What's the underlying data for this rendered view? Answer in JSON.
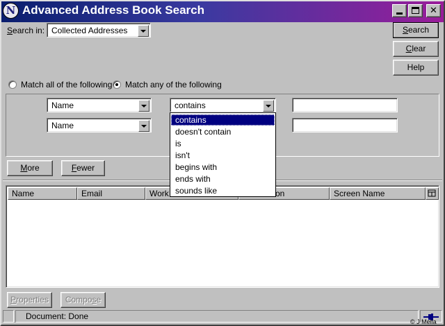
{
  "window": {
    "title": "Advanced Address Book Search",
    "app_icon_letter": "N",
    "controls": {
      "minimize": "minimize-icon",
      "maximize": "maximize-icon",
      "close": "close-icon"
    }
  },
  "search_in": {
    "label_pre": "",
    "label_mnemonic": "S",
    "label_post": "earch in:",
    "value": "Collected Addresses"
  },
  "buttons": {
    "search": {
      "mnemonic": "S",
      "rest": "earch"
    },
    "clear": {
      "mnemonic": "C",
      "rest": "lear"
    },
    "help": "Help",
    "more": {
      "mnemonic": "M",
      "rest": "ore"
    },
    "fewer": {
      "mnemonic": "F",
      "rest": "ewer"
    },
    "properties": {
      "mnemonic": "P",
      "rest": "roperties"
    },
    "compose": {
      "pre": "Compo",
      "mnemonic": "s",
      "post": "e"
    }
  },
  "match": {
    "all_label": "Match all of the following",
    "any_label": "Match any of the following",
    "selected": "any"
  },
  "criteria": [
    {
      "field": "Name",
      "operator": "contains",
      "value": ""
    },
    {
      "field": "Name",
      "operator": "",
      "value": ""
    }
  ],
  "operator_dropdown": {
    "open": true,
    "options": [
      "contains",
      "doesn't contain",
      "is",
      "isn't",
      "begins with",
      "ends with",
      "sounds like"
    ],
    "selected_index": 0
  },
  "results_table": {
    "columns": [
      "Name",
      "Email",
      "Work",
      "",
      "on",
      "Screen Name"
    ],
    "picker_icon": "column-picker-icon",
    "rows": []
  },
  "status_bar": {
    "text": "Document: Done",
    "credit": "© J Mella",
    "icon": "network-plug-icon"
  }
}
